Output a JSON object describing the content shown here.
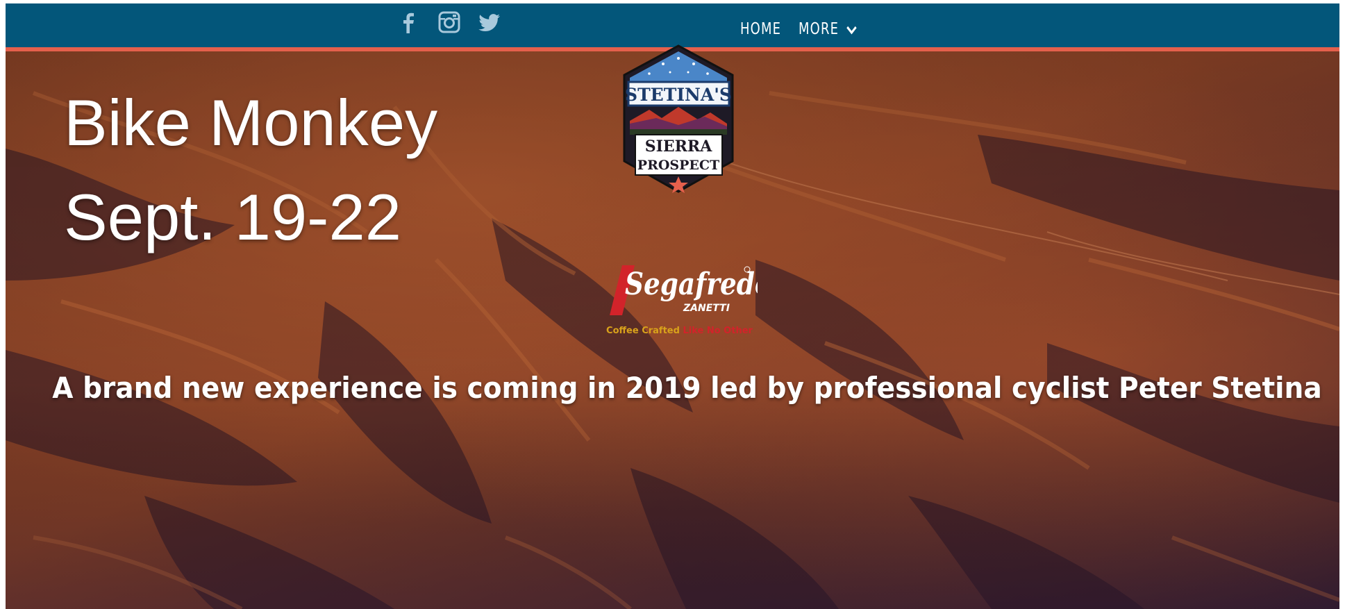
{
  "nav": {
    "social": [
      {
        "name": "facebook-icon"
      },
      {
        "name": "instagram-icon"
      },
      {
        "name": "twitter-icon"
      }
    ],
    "links": {
      "home": "HOME",
      "more": "MORE"
    },
    "colors": {
      "bar": "#03567a",
      "accent": "#e5604c"
    }
  },
  "hero": {
    "title_line1": "Bike Monkey",
    "title_line2": "Sept. 19-22",
    "tagline": "A brand new experience is coming in 2019 led by professional cyclist Peter Stetina"
  },
  "badge": {
    "name_top": "STETINA'S",
    "name_mid": "SIERRA",
    "name_bottom": "PROSPECT"
  },
  "sponsor": {
    "logo_text": "Segafredo",
    "sub_text": "ZANETTI",
    "tag_part1": "Coffee Crafted",
    "tag_part2": "Like No Other",
    "colors": {
      "red": "#d2232a",
      "gold": "#d9a21b"
    }
  }
}
